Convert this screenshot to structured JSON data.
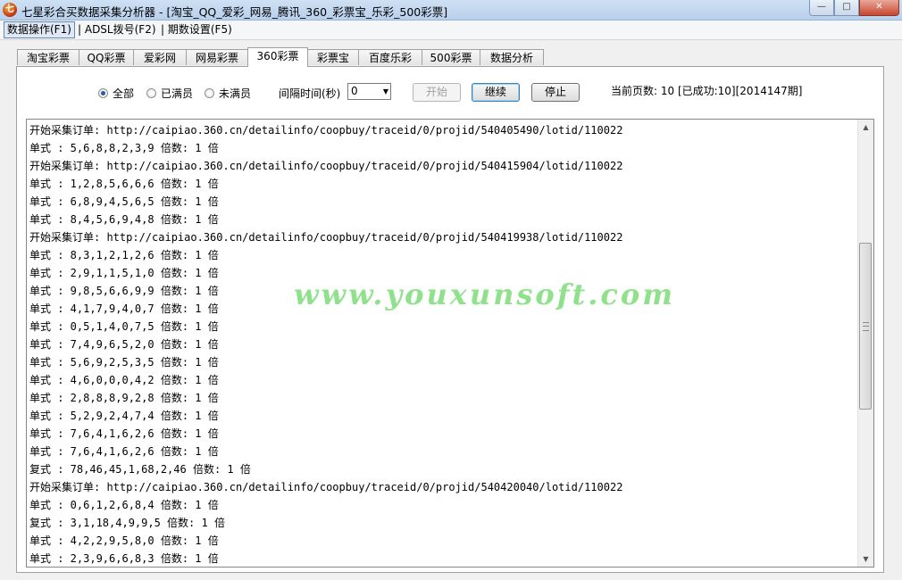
{
  "window": {
    "title": "七星彩合买数据采集分析器 - [淘宝_QQ_爱彩_网易_腾讯_360_彩票宝_乐彩_500彩票]",
    "icon_text": "七"
  },
  "window_buttons": {
    "minimize": "—",
    "maximize": "□",
    "close": "✕"
  },
  "menu": [
    {
      "label": "数据操作(F1)"
    },
    {
      "label": "| ADSL拨号(F2)"
    },
    {
      "label": "| 期数设置(F5)"
    }
  ],
  "tabs": [
    "淘宝彩票",
    "QQ彩票",
    "爱彩网",
    "网易彩票",
    "360彩票",
    "彩票宝",
    "百度乐彩",
    "500彩票",
    "数据分析"
  ],
  "selected_tab": "360彩票",
  "filters": {
    "all": "全部",
    "full": "已满员",
    "not_full": "未满员",
    "selected": "all"
  },
  "interval": {
    "label": "间隔时间(秒)",
    "value": "0"
  },
  "buttons": {
    "start": "开始",
    "continue": "继续",
    "stop": "停止"
  },
  "status": {
    "current_page": "当前页数: 10 [已成功:10][2014147期]"
  },
  "log_lines": [
    "开始采集订单: http://caipiao.360.cn/detailinfo/coopbuy/traceid/0/projid/540405490/lotid/110022",
    "单式 : 5,6,8,8,2,3,9 倍数: 1 倍",
    "开始采集订单: http://caipiao.360.cn/detailinfo/coopbuy/traceid/0/projid/540415904/lotid/110022",
    "单式 : 1,2,8,5,6,6,6 倍数: 1 倍",
    "单式 : 6,8,9,4,5,6,5 倍数: 1 倍",
    "单式 : 8,4,5,6,9,4,8 倍数: 1 倍",
    "开始采集订单: http://caipiao.360.cn/detailinfo/coopbuy/traceid/0/projid/540419938/lotid/110022",
    "单式 : 8,3,1,2,1,2,6 倍数: 1 倍",
    "单式 : 2,9,1,1,5,1,0 倍数: 1 倍",
    "单式 : 9,8,5,6,6,9,9 倍数: 1 倍",
    "单式 : 4,1,7,9,4,0,7 倍数: 1 倍",
    "单式 : 0,5,1,4,0,7,5 倍数: 1 倍",
    "单式 : 7,4,9,6,5,2,0 倍数: 1 倍",
    "单式 : 5,6,9,2,5,3,5 倍数: 1 倍",
    "单式 : 4,6,0,0,0,4,2 倍数: 1 倍",
    "单式 : 2,8,8,8,9,2,8 倍数: 1 倍",
    "单式 : 5,2,9,2,4,7,4 倍数: 1 倍",
    "单式 : 7,6,4,1,6,2,6 倍数: 1 倍",
    "单式 : 7,6,4,1,6,2,6 倍数: 1 倍",
    "复式 : 78,46,45,1,68,2,46 倍数: 1 倍",
    "开始采集订单: http://caipiao.360.cn/detailinfo/coopbuy/traceid/0/projid/540420040/lotid/110022",
    "单式 : 0,6,1,2,6,8,4 倍数: 1 倍",
    "复式 : 3,1,18,4,9,9,5 倍数: 1 倍",
    "单式 : 4,2,2,9,5,8,0 倍数: 1 倍",
    "单式 : 2,3,9,6,6,8,3 倍数: 1 倍"
  ],
  "watermark": "www.youxunsoft.com",
  "scrollbar": {
    "up": "▲",
    "down": "▼"
  }
}
